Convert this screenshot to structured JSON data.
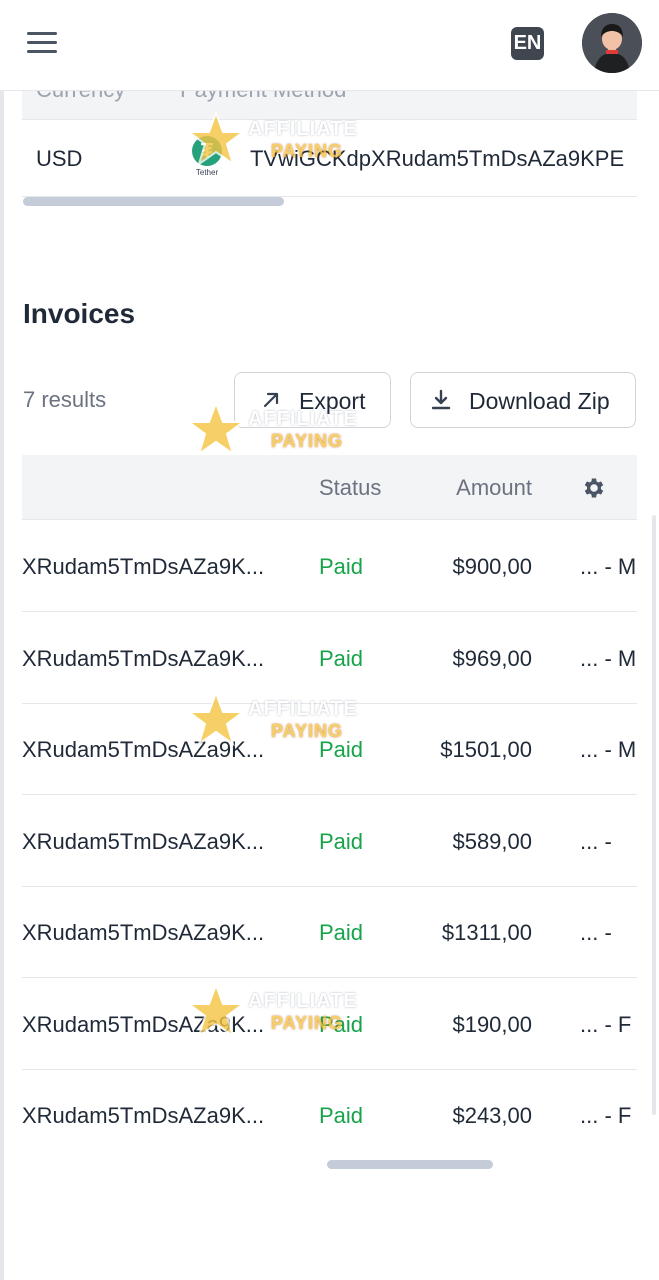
{
  "header": {
    "menu_icon": "hamburger-menu-icon",
    "language": "EN",
    "avatar_icon": "user-avatar"
  },
  "payment_methods": {
    "columns": [
      "Currency",
      "Payment Method"
    ],
    "row": {
      "currency": "USD",
      "method_icon": "tether-icon",
      "method_logo_text": "Tether",
      "address": "TVwiGCKdpXRudam5TmDsAZa9KPE"
    }
  },
  "invoices": {
    "title": "Invoices",
    "results": "7 results",
    "export_label": "Export",
    "download_zip_label": "Download Zip",
    "columns": {
      "status": "Status",
      "amount": "Amount"
    },
    "rows": [
      {
        "id": "XRudam5TmDsAZa9K...",
        "status": "Paid",
        "amount": "$900,00",
        "date": "... - M"
      },
      {
        "id": "XRudam5TmDsAZa9K...",
        "status": "Paid",
        "amount": "$969,00",
        "date": "... - M"
      },
      {
        "id": "XRudam5TmDsAZa9K...",
        "status": "Paid",
        "amount": "$1501,00",
        "date": "... - M"
      },
      {
        "id": "XRudam5TmDsAZa9K...",
        "status": "Paid",
        "amount": "$589,00",
        "date": "... -"
      },
      {
        "id": "XRudam5TmDsAZa9K...",
        "status": "Paid",
        "amount": "$1311,00",
        "date": "... -"
      },
      {
        "id": "XRudam5TmDsAZa9K...",
        "status": "Paid",
        "amount": "$190,00",
        "date": "... - F"
      },
      {
        "id": "XRudam5TmDsAZa9K...",
        "status": "Paid",
        "amount": "$243,00",
        "date": "... - F"
      }
    ]
  },
  "watermark": {
    "line1": "AFFILIATE",
    "line2": "PAYING"
  },
  "colors": {
    "paid": "#16a34a",
    "tether": "#26a17b",
    "header_bg": "#f3f4f6"
  }
}
